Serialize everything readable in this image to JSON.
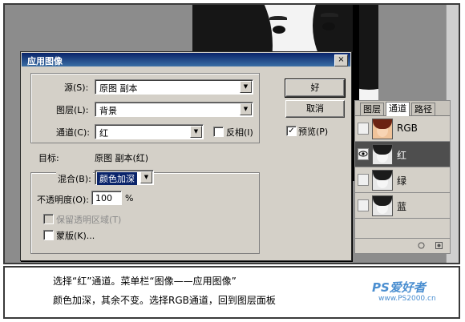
{
  "dialog": {
    "title": "应用图像",
    "close_symbol": "×",
    "source_label": "源(S):",
    "source_value": "原图 副本",
    "layer_label": "图层(L):",
    "layer_value": "背景",
    "channel_label": "通道(C):",
    "channel_value": "红",
    "invert_label": "反相(I)",
    "ok_label": "好",
    "cancel_label": "取消",
    "preview_label": "预览(P)",
    "preview_checked": true,
    "target_label": "目标:",
    "target_value": "原图 副本(红)",
    "blend_label": "混合(B):",
    "blend_value": "颜色加深",
    "opacity_label": "不透明度(O):",
    "opacity_value": "100",
    "opacity_unit": "%",
    "preserve_label": "保留透明区域(T)",
    "mask_label": "蒙版(K)..."
  },
  "panel": {
    "tabs": [
      "图层",
      "通道",
      "路径"
    ],
    "active_tab": 1,
    "channels": [
      {
        "name": "RGB",
        "selected": false,
        "visible": false
      },
      {
        "name": "红",
        "selected": true,
        "visible": true
      },
      {
        "name": "绿",
        "selected": false,
        "visible": false
      },
      {
        "name": "蓝",
        "selected": false,
        "visible": false
      }
    ]
  },
  "caption": {
    "line1": "选择“红”通道。菜单栏“图像——应用图像”",
    "line2": "颜色加深，其余不变。选择RGB通道，回到图层面板"
  },
  "logo": {
    "name": "PS爱好者",
    "url": "www.PS2000.cn"
  },
  "icons": {
    "dropdown": "chevron-down-icon",
    "eye": "eye-icon",
    "check": "checkmark-icon"
  }
}
